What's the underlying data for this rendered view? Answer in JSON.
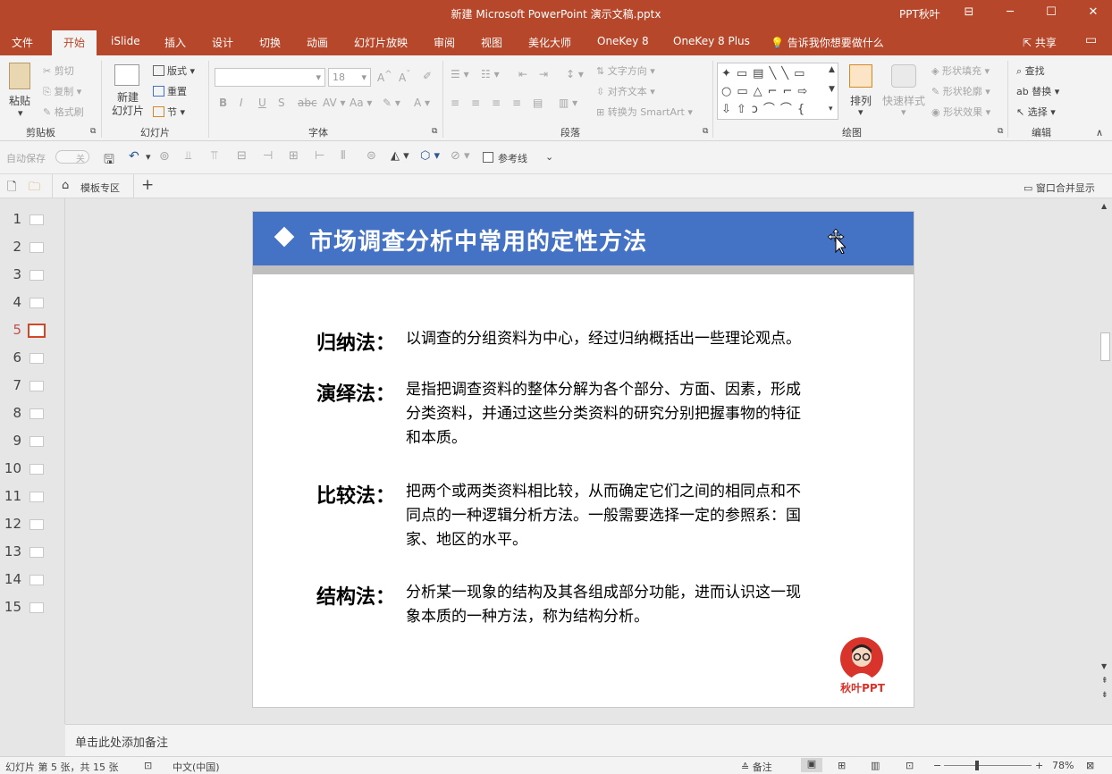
{
  "title": "新建 Microsoft PowerPoint 演示文稿.pptx",
  "user": "PPT秋叶",
  "tabs": [
    "文件",
    "开始",
    "iSlide",
    "插入",
    "设计",
    "切换",
    "动画",
    "幻灯片放映",
    "审阅",
    "视图",
    "美化大师",
    "OneKey 8",
    "OneKey 8 Plus"
  ],
  "tell_me": "告诉我你想要做什么",
  "share": "共享",
  "ribbon": {
    "paste": "粘贴",
    "cut": "剪切",
    "copy": "复制",
    "format_painter": "格式刷",
    "clipboard": "剪贴板",
    "new_slide": "新建\n幻灯片",
    "layout": "版式",
    "reset": "重置",
    "section": "节",
    "slides": "幻灯片",
    "font_size": "18",
    "font": "字体",
    "text_direction": "文字方向",
    "align_text": "对齐文本",
    "smartart": "转换为 SmartArt",
    "paragraph": "段落",
    "arrange": "排列",
    "quick_styles": "快速样式",
    "shape_fill": "形状填充",
    "shape_outline": "形状轮廓",
    "shape_effects": "形状效果",
    "drawing": "绘图",
    "find": "查找",
    "replace": "替换",
    "select": "选择",
    "editing": "编辑"
  },
  "qat": {
    "autosave": "自动保存",
    "autosave_state": "关",
    "guides": "参考线"
  },
  "tabstrip": {
    "templates": "模板专区",
    "merge": "窗口合并显示"
  },
  "thumbnails": {
    "count": 15,
    "current": 5
  },
  "slide": {
    "title": "市场调查分析中常用的定性方法",
    "items": [
      {
        "term": "归纳法：",
        "lines": [
          "以调查的分组资料为中心，经过归纳概括出一些理论观点。"
        ]
      },
      {
        "term": "演绎法：",
        "lines": [
          "是指把调查资料的整体分解为各个部分、方面、因素，形成",
          "分类资料，并通过这些分类资料的研究分别把握事物的特征",
          "和本质。"
        ]
      },
      {
        "term": "比较法：",
        "lines": [
          "把两个或两类资料相比较，从而确定它们之间的相同点和不",
          "同点的一种逻辑分析方法。一般需要选择一定的参照系：国",
          "家、地区的水平。"
        ]
      },
      {
        "term": "结构法：",
        "lines": [
          "分析某一现象的结构及其各组成部分功能，进而认识这一现",
          "象本质的一种方法，称为结构分析。"
        ]
      }
    ],
    "logo_text": "秋叶PPT"
  },
  "notes_placeholder": "单击此处添加备注",
  "status": {
    "slide_info": "幻灯片 第 5 张，共 15 张",
    "language": "中文(中国)",
    "notes": "备注",
    "zoom": "78%"
  }
}
